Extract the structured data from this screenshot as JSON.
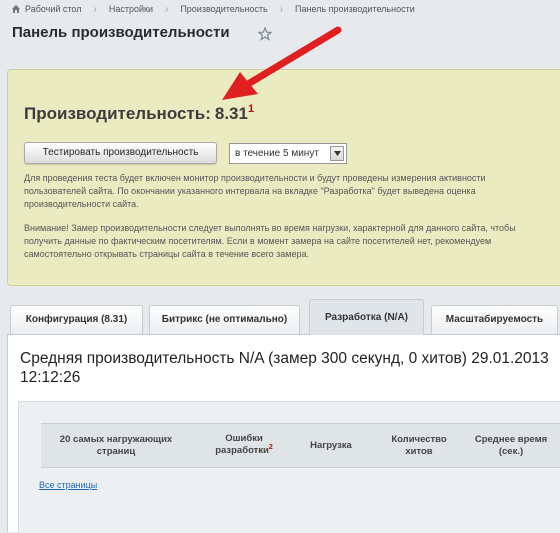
{
  "breadcrumb": {
    "items": [
      "Рабочий стол",
      "Настройки",
      "Производительность",
      "Панель производительности"
    ]
  },
  "page": {
    "title": "Панель производительности"
  },
  "performance": {
    "label": "Производительность:",
    "value": "8.31",
    "footnote": "1",
    "test_button_label": "Тестировать производительность",
    "duration_select": {
      "selected": "в течение 5 минут"
    },
    "info_text_1": "Для проведения теста будет включен монитор производительности и будут проведены измерения активности пользователей сайта. По окончании указанного интервала на вкладке \"Разработка\" будет выведена оценка производительности сайта.",
    "info_text_2": "Внимание! Замер производительности следует выполнять во время нагрузки, характерной для данного сайта, чтобы получить данные по фактическим посетителям. Если в момент замера на сайте посетителей нет, рекомендуем самостоятельно открывать страницы сайта в течение всего замера."
  },
  "tabs": [
    {
      "label": "Конфигурация (8.31)",
      "active": false
    },
    {
      "label": "Битрикс (не оптимально)",
      "active": false
    },
    {
      "label": "Разработка (N/A)",
      "active": true
    },
    {
      "label": "Масштабируемость",
      "active": false
    }
  ],
  "content": {
    "title": "Средняя производительность N/A (замер 300 секунд, 0 хитов) 29.01.2013 12:12:26",
    "table": {
      "columns": [
        {
          "label": "20 самых нагружающих страниц"
        },
        {
          "label": "Ошибки разработки",
          "footnote": "2"
        },
        {
          "label": "Нагрузка"
        },
        {
          "label": "Количество хитов"
        },
        {
          "label": "Среднее время (сек.)"
        }
      ]
    },
    "all_pages_link": "Все страницы"
  },
  "colors": {
    "panel_background": "#ebebc2",
    "arrow": "#e02020",
    "footnote": "#cc0000",
    "link": "#2067b0",
    "active_tab": "#dfe5e8"
  }
}
